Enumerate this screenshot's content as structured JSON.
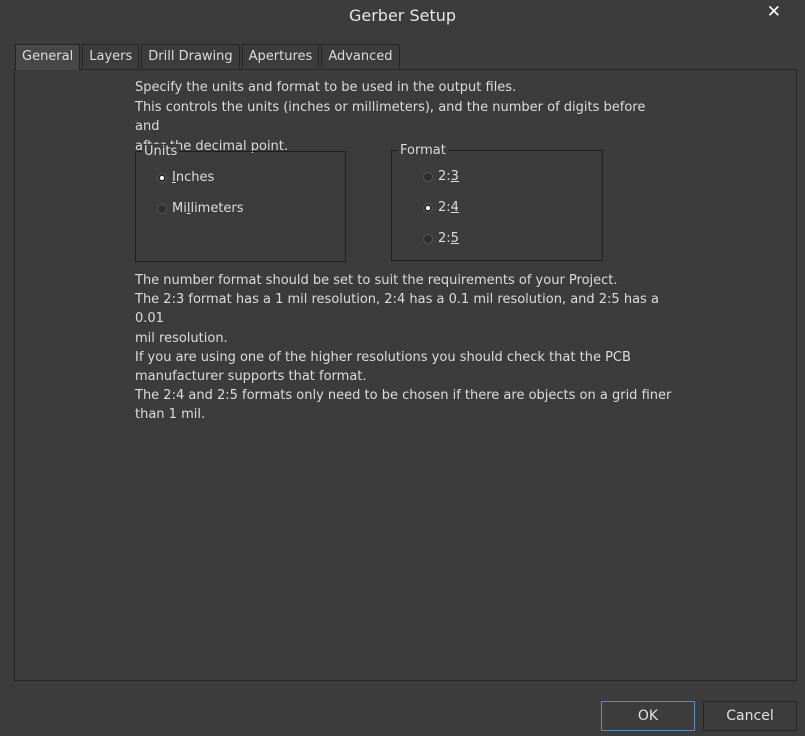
{
  "window": {
    "title": "Gerber Setup"
  },
  "tabs": [
    {
      "label": "General",
      "active": true
    },
    {
      "label": "Layers",
      "active": false
    },
    {
      "label": "Drill Drawing",
      "active": false
    },
    {
      "label": "Apertures",
      "active": false
    },
    {
      "label": "Advanced",
      "active": false
    }
  ],
  "general": {
    "intro": [
      "Specify the units and format to be used in the output files.",
      "This controls the units (inches or millimeters), and the number of digits before and",
      "after the decimal point."
    ],
    "units": {
      "legend": "Units",
      "options": [
        {
          "label_pre": "",
          "label_u": "I",
          "label_post": "nches",
          "checked": true
        },
        {
          "label_pre": "Mi",
          "label_u": "l",
          "label_post": "limeters",
          "checked": false
        }
      ]
    },
    "format": {
      "legend": "Format",
      "options": [
        {
          "label_pre": "2:",
          "label_u": "3",
          "label_post": "",
          "checked": false
        },
        {
          "label_pre": "2:",
          "label_u": "4",
          "label_post": "",
          "checked": true
        },
        {
          "label_pre": "2:",
          "label_u": "5",
          "label_post": "",
          "checked": false
        }
      ]
    },
    "info": [
      "The number format should be set to suit the requirements of your Project.",
      "The 2:3 format has a 1 mil resolution, 2:4 has a 0.1 mil resolution, and 2:5 has a 0.01",
      "mil resolution.",
      "If you are using one of the higher resolutions you should check that the PCB",
      "manufacturer supports that format.",
      "The 2:4 and 2:5 formats only need to be chosen if there are objects on a grid finer",
      "than 1 mil."
    ]
  },
  "buttons": {
    "ok": "OK",
    "cancel": "Cancel"
  },
  "icons": {
    "close": "close-icon"
  },
  "colors": {
    "background": "#3c3c3c",
    "accent_border": "#5a8cbf",
    "text": "#dcdcdc"
  }
}
